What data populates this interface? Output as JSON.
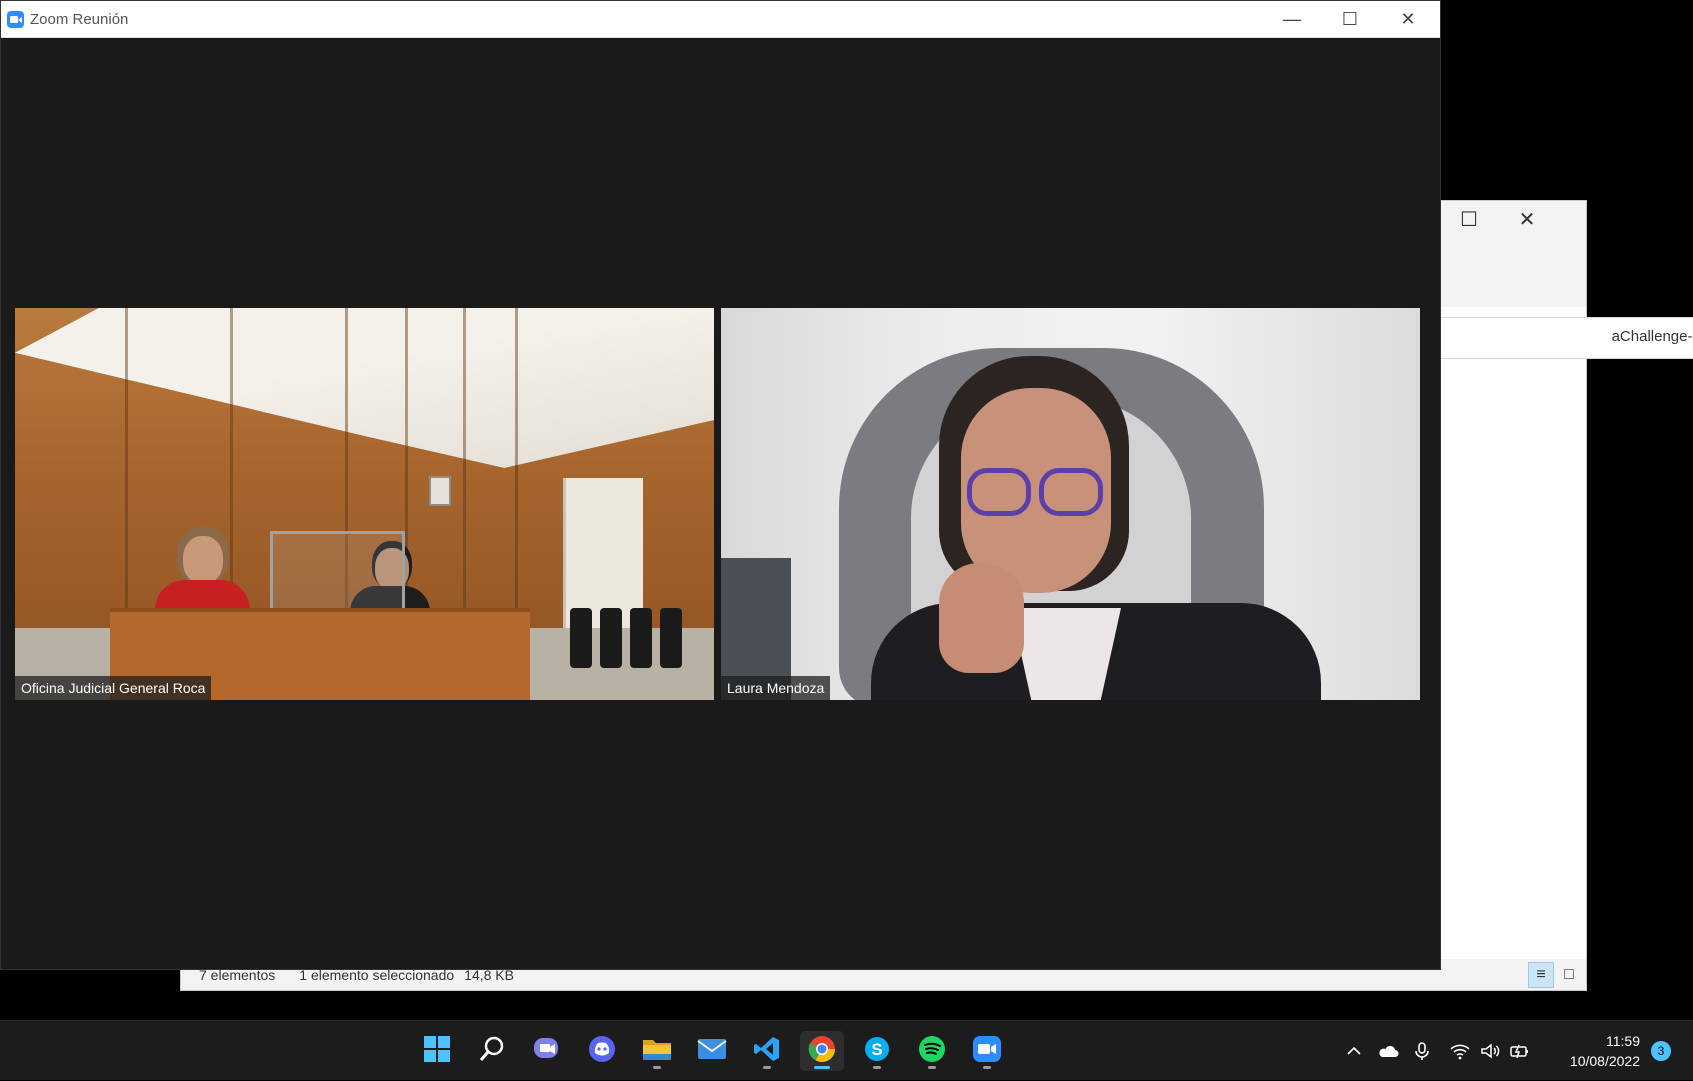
{
  "zoom": {
    "title": "Zoom Reunión",
    "minimize": "—",
    "maximize": "☐",
    "close": "✕",
    "participants": [
      {
        "name": "Oficina Judicial General Roca"
      },
      {
        "name": "Laura Mendoza"
      }
    ]
  },
  "explorer": {
    "maximize": "☐",
    "close": "✕",
    "tab_label": "aChallenge-Front-...",
    "status_items": "7 elementos",
    "status_selected": "1 elemento seleccionado",
    "status_size": "14,8 KB",
    "view_details": "≡",
    "view_large": "□"
  },
  "taskbar": {
    "apps": [
      {
        "name": "start-button",
        "icon": "windows-logo",
        "color": "#4cc2ff"
      },
      {
        "name": "search",
        "icon": "search-icon",
        "color": "#ffffff"
      },
      {
        "name": "teams-chat",
        "icon": "chat-icon",
        "color": "#7b83eb"
      },
      {
        "name": "discord",
        "icon": "discord-icon",
        "color": "#5865f2"
      },
      {
        "name": "file-explorer",
        "icon": "folder-icon",
        "color": "#f8c233"
      },
      {
        "name": "mail",
        "icon": "mail-icon",
        "color": "#3a8fe0"
      },
      {
        "name": "vscode",
        "icon": "vscode-icon",
        "color": "#2aa4f4"
      },
      {
        "name": "chrome",
        "icon": "chrome-icon",
        "color": "#ea4335"
      },
      {
        "name": "skype",
        "icon": "skype-icon",
        "color": "#00aff0"
      },
      {
        "name": "spotify",
        "icon": "spotify-icon",
        "color": "#1ed760"
      },
      {
        "name": "zoom",
        "icon": "zoom-icon",
        "color": "#2d8cff"
      }
    ],
    "time": "11:59",
    "date": "10/08/2022",
    "notification_count": "3"
  }
}
